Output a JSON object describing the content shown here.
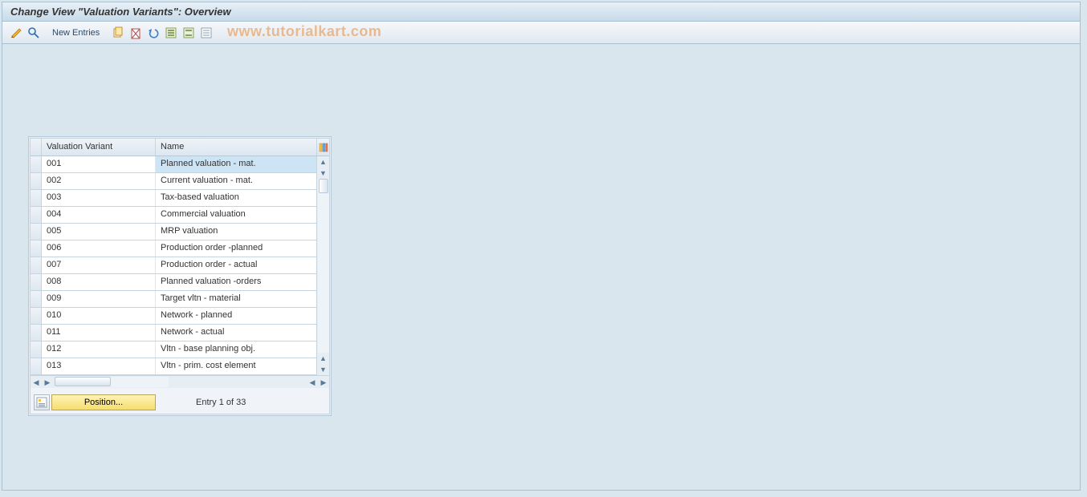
{
  "header": {
    "title": "Change View \"Valuation Variants\": Overview"
  },
  "toolbar": {
    "new_entries_label": "New Entries"
  },
  "watermark": "www.tutorialkart.com",
  "grid": {
    "columns": {
      "variant": "Valuation Variant",
      "name": "Name"
    },
    "rows": [
      {
        "variant": "001",
        "name": "Planned valuation - mat.",
        "selected": true
      },
      {
        "variant": "002",
        "name": "Current valuation - mat."
      },
      {
        "variant": "003",
        "name": "Tax-based valuation"
      },
      {
        "variant": "004",
        "name": "Commercial valuation"
      },
      {
        "variant": "005",
        "name": "MRP valuation"
      },
      {
        "variant": "006",
        "name": "Production order -planned"
      },
      {
        "variant": "007",
        "name": "Production order - actual"
      },
      {
        "variant": "008",
        "name": "Planned valuation -orders"
      },
      {
        "variant": "009",
        "name": "Target vltn - material"
      },
      {
        "variant": "010",
        "name": "Network - planned"
      },
      {
        "variant": "011",
        "name": "Network - actual"
      },
      {
        "variant": "012",
        "name": "Vltn - base planning obj."
      },
      {
        "variant": "013",
        "name": "Vltn - prim. cost element"
      }
    ]
  },
  "footer": {
    "position_label": "Position...",
    "entry_status": "Entry 1 of 33"
  }
}
